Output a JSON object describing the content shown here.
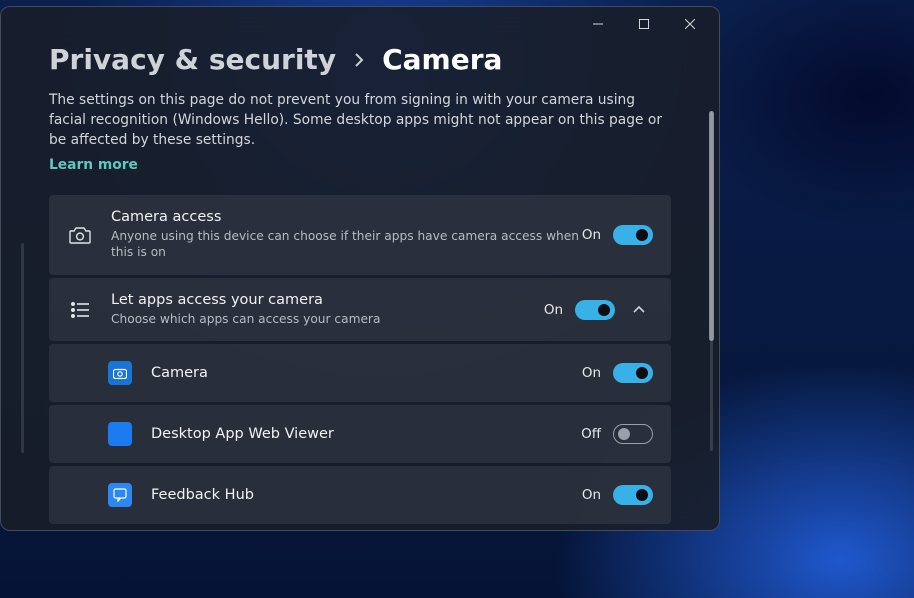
{
  "breadcrumb": {
    "parent": "Privacy & security",
    "current": "Camera"
  },
  "description": "The settings on this page do not prevent you from signing in with your camera using facial recognition (Windows Hello). Some desktop apps might not appear on this page or be affected by these settings.",
  "learn_more": "Learn more",
  "settings": {
    "camera_access": {
      "title": "Camera access",
      "subtitle": "Anyone using this device can choose if their apps have camera access when this is on",
      "state_label": "On",
      "on": true
    },
    "let_apps": {
      "title": "Let apps access your camera",
      "subtitle": "Choose which apps can access your camera",
      "state_label": "On",
      "on": true,
      "expanded": true
    }
  },
  "apps": [
    {
      "name": "Camera",
      "state_label": "On",
      "on": true,
      "tile": "tile-blue"
    },
    {
      "name": "Desktop App Web Viewer",
      "state_label": "Off",
      "on": false,
      "tile": "tile-solid"
    },
    {
      "name": "Feedback Hub",
      "state_label": "On",
      "on": true,
      "tile": "tile-fb"
    }
  ]
}
